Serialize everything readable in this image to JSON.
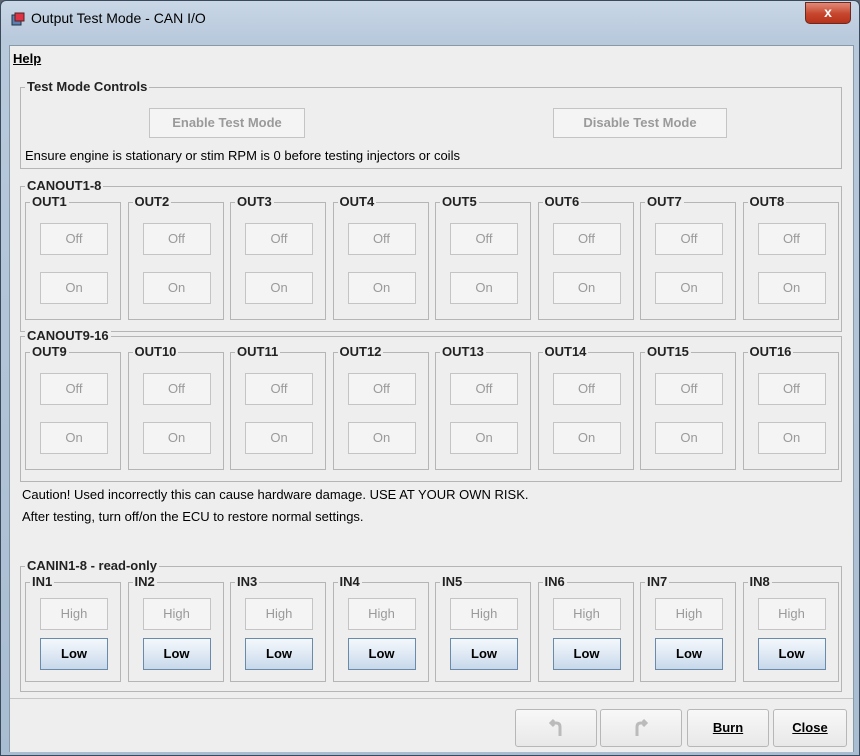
{
  "window": {
    "title": "Output Test Mode - CAN I/O",
    "close": "x"
  },
  "menu": {
    "help": "Help"
  },
  "test_controls": {
    "title": "Test Mode Controls",
    "enable": "Enable Test Mode",
    "disable": "Disable Test Mode",
    "note": "Ensure engine is stationary or stim RPM is 0 before testing injectors or coils"
  },
  "canout1_8": {
    "title": "CANOUT1-8",
    "outputs": [
      {
        "name": "OUT1",
        "off": "Off",
        "on": "On"
      },
      {
        "name": "OUT2",
        "off": "Off",
        "on": "On"
      },
      {
        "name": "OUT3",
        "off": "Off",
        "on": "On"
      },
      {
        "name": "OUT4",
        "off": "Off",
        "on": "On"
      },
      {
        "name": "OUT5",
        "off": "Off",
        "on": "On"
      },
      {
        "name": "OUT6",
        "off": "Off",
        "on": "On"
      },
      {
        "name": "OUT7",
        "off": "Off",
        "on": "On"
      },
      {
        "name": "OUT8",
        "off": "Off",
        "on": "On"
      }
    ]
  },
  "canout9_16": {
    "title": "CANOUT9-16",
    "outputs": [
      {
        "name": "OUT9",
        "off": "Off",
        "on": "On"
      },
      {
        "name": "OUT10",
        "off": "Off",
        "on": "On"
      },
      {
        "name": "OUT11",
        "off": "Off",
        "on": "On"
      },
      {
        "name": "OUT12",
        "off": "Off",
        "on": "On"
      },
      {
        "name": "OUT13",
        "off": "Off",
        "on": "On"
      },
      {
        "name": "OUT14",
        "off": "Off",
        "on": "On"
      },
      {
        "name": "OUT15",
        "off": "Off",
        "on": "On"
      },
      {
        "name": "OUT16",
        "off": "Off",
        "on": "On"
      }
    ]
  },
  "caution": {
    "line1": "Caution! Used incorrectly this can cause hardware damage. USE AT YOUR OWN RISK.",
    "line2": "After testing, turn off/on the ECU to restore normal settings."
  },
  "canin1_8": {
    "title": "CANIN1-8 - read-only",
    "inputs": [
      {
        "name": "IN1",
        "high": "High",
        "low": "Low"
      },
      {
        "name": "IN2",
        "high": "High",
        "low": "Low"
      },
      {
        "name": "IN3",
        "high": "High",
        "low": "Low"
      },
      {
        "name": "IN4",
        "high": "High",
        "low": "Low"
      },
      {
        "name": "IN5",
        "high": "High",
        "low": "Low"
      },
      {
        "name": "IN6",
        "high": "High",
        "low": "Low"
      },
      {
        "name": "IN7",
        "high": "High",
        "low": "Low"
      },
      {
        "name": "IN8",
        "high": "High",
        "low": "Low"
      }
    ]
  },
  "footer": {
    "undo_icon": "undo-arrow-icon",
    "redo_icon": "redo-arrow-icon",
    "burn": "Burn",
    "close": "Close"
  },
  "colors": {
    "title_bar": "#b8c9dc",
    "panel": "#eeeeee",
    "active_button": "#c7d8ea",
    "close_button": "#c6452c"
  }
}
